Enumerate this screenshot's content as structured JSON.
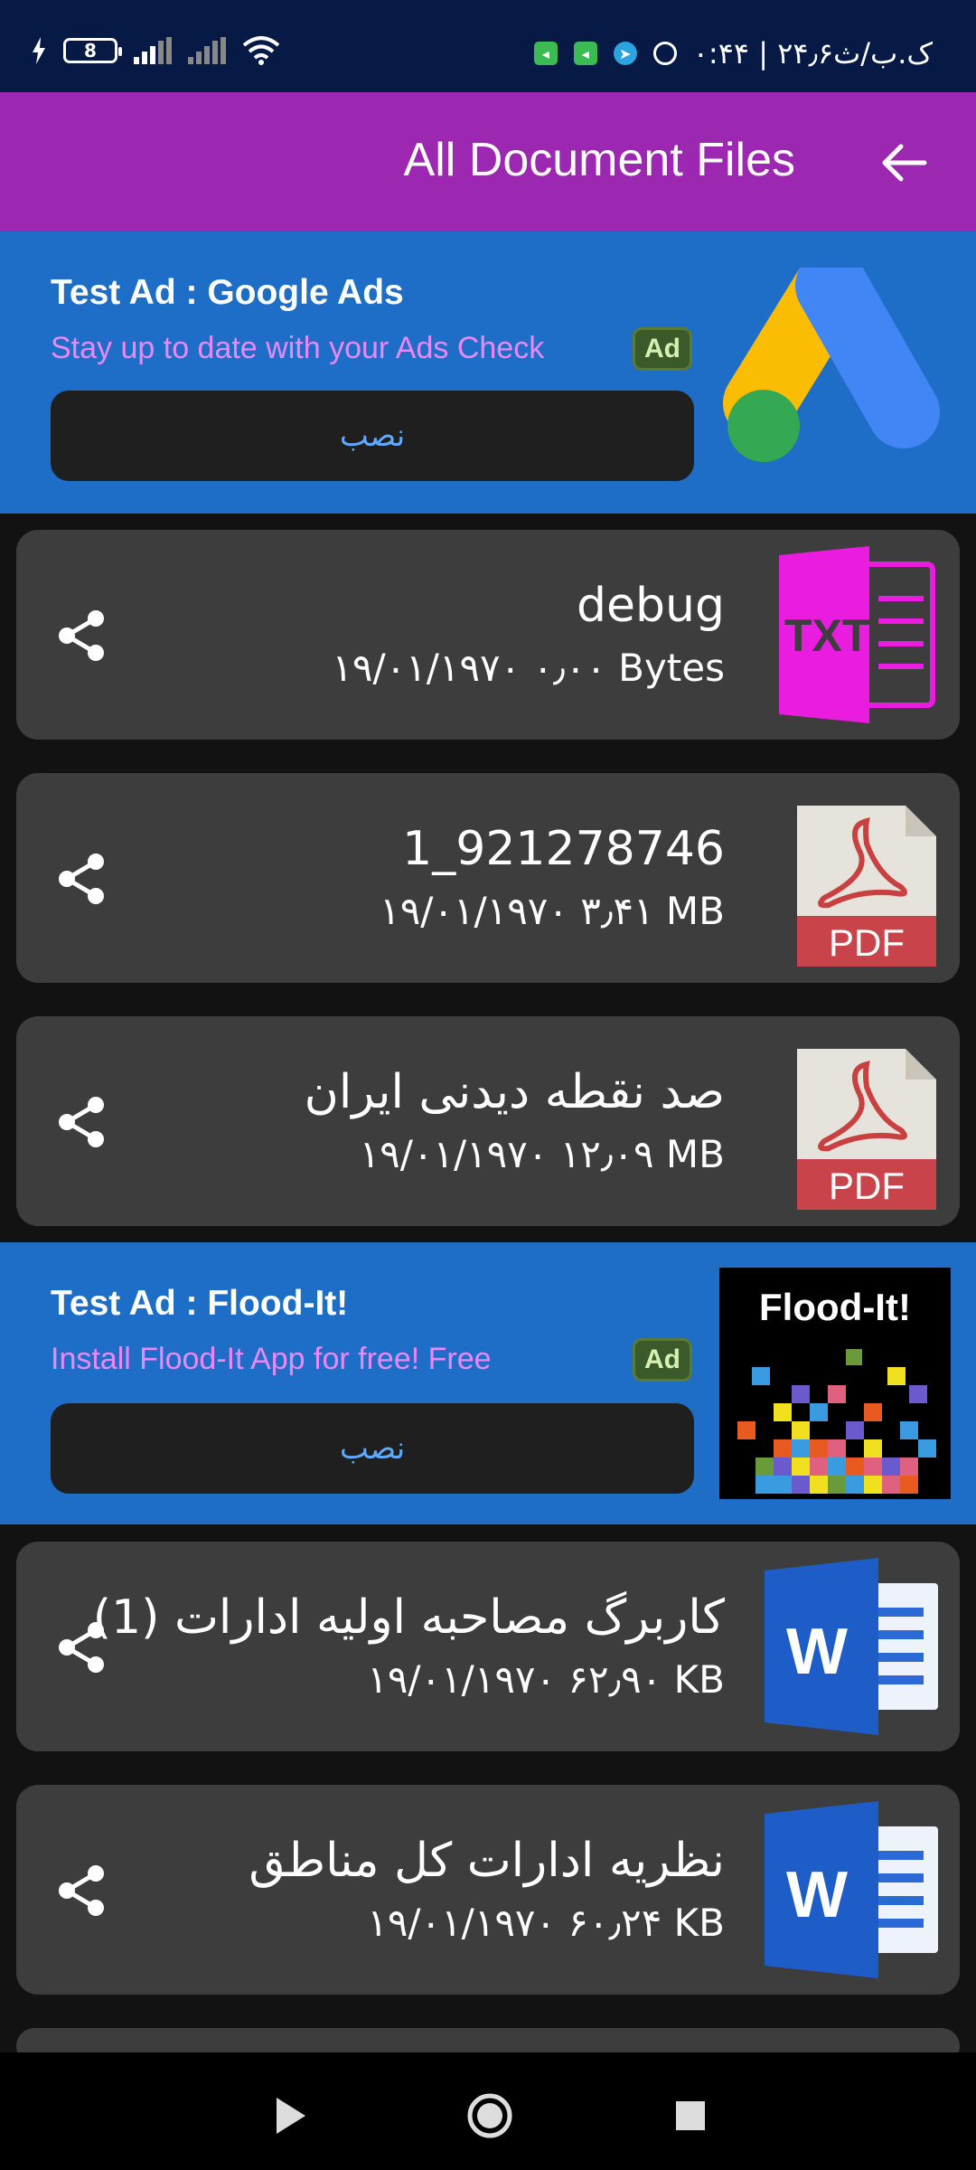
{
  "status_bar": {
    "time": "۰:۴۴ | ۲۴٫۶ک.ب/ث",
    "battery": "8"
  },
  "app_bar": {
    "title": "All Document Files"
  },
  "ads": [
    {
      "title": "Test Ad : Google Ads",
      "description": "Stay up to date with your Ads Check",
      "badge": "Ad",
      "install_label": "نصب"
    },
    {
      "title": "Test Ad : Flood-It!",
      "description": "Install Flood-It App for free! Free",
      "badge": "Ad",
      "install_label": "نصب",
      "logo_text": "Flood-It!"
    }
  ],
  "files": [
    {
      "name": "debug",
      "meta": "۱۹/۰۱/۱۹۷۰ ۰٫۰۰ Bytes",
      "type": "txt",
      "type_label": "TXT"
    },
    {
      "name": "921278746_1",
      "meta": "۱۹/۰۱/۱۹۷۰ ۳٫۴۱ MB",
      "type": "pdf",
      "type_label": "PDF"
    },
    {
      "name": "صد نقطه دیدنی ایران",
      "meta": "۱۹/۰۱/۱۹۷۰ ۱۲٫۰۹ MB",
      "type": "pdf",
      "type_label": "PDF"
    },
    {
      "name": "کاربرگ مصاحبه اولیه ادارات (1)",
      "meta": "۱۹/۰۱/۱۹۷۰ ۶۲٫۹۰ KB",
      "type": "doc",
      "type_label": "W"
    },
    {
      "name": "نظریه ادارات کل مناطق",
      "meta": "۱۹/۰۱/۱۹۷۰ ۶۰٫۲۴ KB",
      "type": "doc",
      "type_label": "W"
    }
  ],
  "colors": {
    "app_bar": "#9c27b0",
    "ad_background": "#1e6ec8",
    "card_background": "#3d3d3d",
    "ad_description": "#e889ff"
  }
}
